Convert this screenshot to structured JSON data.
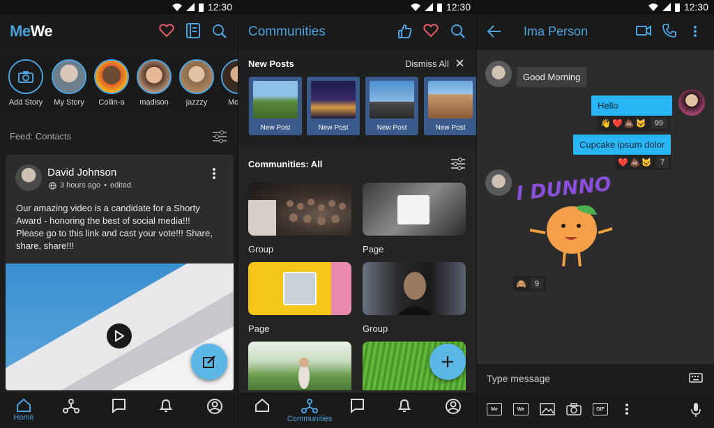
{
  "status": {
    "time": "12:30"
  },
  "screen1": {
    "logo": {
      "me": "Me",
      "we": "We"
    },
    "stories": [
      {
        "label": "Add Story"
      },
      {
        "label": "My Story"
      },
      {
        "label": "Collin-a"
      },
      {
        "label": "madison"
      },
      {
        "label": "jazzzy"
      },
      {
        "label": "Mo"
      }
    ],
    "feed_label": "Feed: Contacts",
    "post": {
      "author": "David Johnson",
      "time": "3 hours ago",
      "edited": "edited",
      "separator": "•",
      "text": "Our amazing video is a candidate for a Shorty Award - honoring the best of social media!!! Please go to this link and cast your vote!!! Share, share, share!!!"
    },
    "nav": {
      "home": "Home"
    }
  },
  "screen2": {
    "title": "Communities",
    "new_posts": {
      "heading": "New Posts",
      "dismiss": "Dismiss All",
      "items": [
        "New Post",
        "New Post",
        "New Post",
        "New Post"
      ]
    },
    "filter_label": "Communities: All",
    "communities": [
      {
        "type": "Group"
      },
      {
        "type": "Page"
      },
      {
        "type": "Page"
      },
      {
        "type": "Group"
      }
    ],
    "nav": {
      "communities": "Communities"
    }
  },
  "screen3": {
    "contact": "Ima Person",
    "messages": [
      {
        "text": "Good Morning"
      },
      {
        "text": "Hello",
        "count": "99"
      },
      {
        "text": "Cupcake ipsum dolor",
        "count": "7"
      }
    ],
    "sticker": {
      "text": "I DUNNO",
      "count": "9"
    },
    "input_placeholder": "Type message",
    "toolbar": {
      "me": "Me",
      "we": "We",
      "gif": "GIF"
    }
  },
  "colors": {
    "accent": "#4aa3df",
    "bubble_blue": "#29b6f6",
    "bubble_gray": "#3a3a3a",
    "background": "#1c1c1c"
  }
}
